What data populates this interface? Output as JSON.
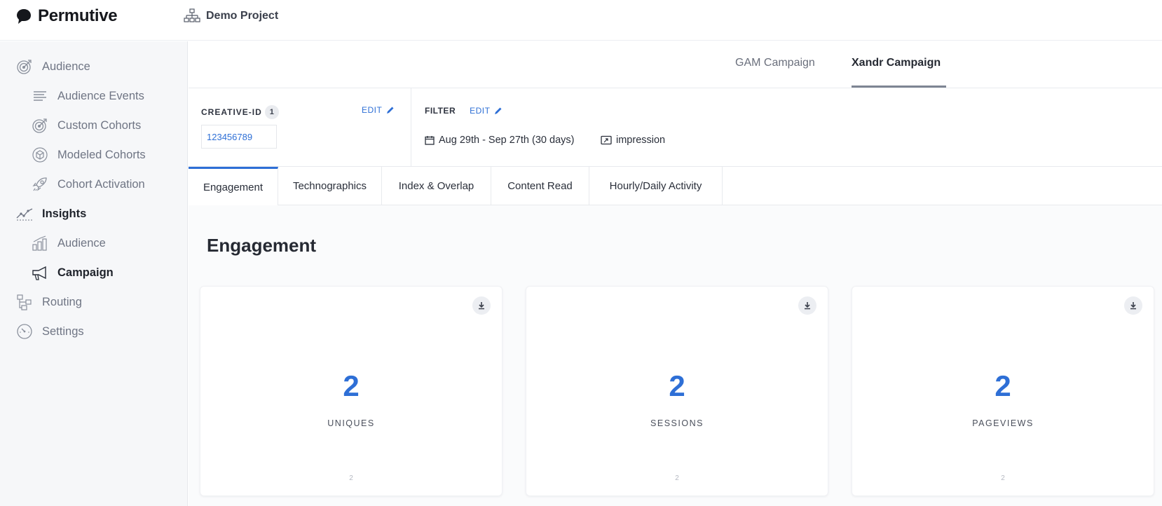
{
  "brand": {
    "name": "Permutive"
  },
  "project": {
    "name": "Demo Project"
  },
  "sidebar": {
    "items": [
      {
        "label": "Audience",
        "icon": "target-icon"
      },
      {
        "label": "Audience Events",
        "icon": "list-lines-icon"
      },
      {
        "label": "Custom Cohorts",
        "icon": "target-icon"
      },
      {
        "label": "Modeled Cohorts",
        "icon": "cube-icon"
      },
      {
        "label": "Cohort Activation",
        "icon": "rocket-icon"
      },
      {
        "label": "Insights",
        "icon": "trend-line-icon"
      },
      {
        "label": "Audience",
        "icon": "bar-people-icon"
      },
      {
        "label": "Campaign",
        "icon": "megaphone-icon"
      },
      {
        "label": "Routing",
        "icon": "routing-icon"
      },
      {
        "label": "Settings",
        "icon": "gauge-icon"
      }
    ]
  },
  "campaign_tabs": [
    {
      "label": "GAM Campaign",
      "active": false
    },
    {
      "label": "Xandr Campaign",
      "active": true
    }
  ],
  "creative": {
    "label": "CREATIVE-ID",
    "count": "1",
    "edit_label": "EDIT",
    "value": "123456789"
  },
  "filter": {
    "label": "FILTER",
    "edit_label": "EDIT",
    "date_range": "Aug 29th - Sep 27th (30 days)",
    "event_type": "impression"
  },
  "section_tabs": [
    {
      "label": "Engagement",
      "active": true
    },
    {
      "label": "Technographics",
      "active": false
    },
    {
      "label": "Index & Overlap",
      "active": false
    },
    {
      "label": "Content Read",
      "active": false
    },
    {
      "label": "Hourly/Daily Activity",
      "active": false
    }
  ],
  "section": {
    "title": "Engagement"
  },
  "cards": [
    {
      "value": "2",
      "label": "UNIQUES",
      "sub": "2"
    },
    {
      "value": "2",
      "label": "SESSIONS",
      "sub": "2"
    },
    {
      "value": "2",
      "label": "PAGEVIEWS",
      "sub": "2"
    }
  ],
  "colors": {
    "accent": "#2e6fd6",
    "sidebar_bg": "#f6f7f9",
    "main_bg": "#fafbfc"
  }
}
